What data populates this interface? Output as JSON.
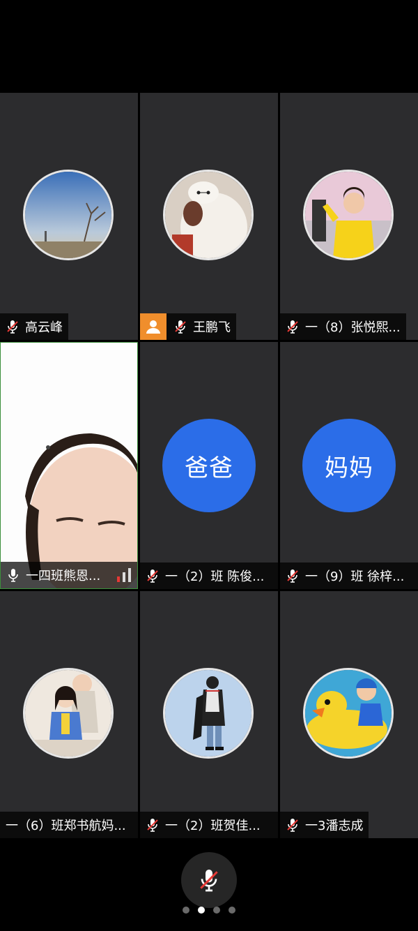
{
  "participants": [
    {
      "name": "高云峰",
      "muted": true,
      "host": false
    },
    {
      "name": "王鹏飞",
      "muted": true,
      "host": true
    },
    {
      "name": "一（8）张悦熙...",
      "muted": true,
      "host": false
    },
    {
      "name": "一四班熊恩...",
      "muted": false,
      "host": false
    },
    {
      "name": "一（2）班 陈俊...",
      "muted": true,
      "host": false,
      "initials": "爸爸"
    },
    {
      "name": "一（9）班  徐梓...",
      "muted": true,
      "host": false,
      "initials": "妈妈"
    },
    {
      "name": "一（6）班郑书航妈...",
      "muted": false,
      "host": false
    },
    {
      "name": "一（2）班贺佳...",
      "muted": true,
      "host": false
    },
    {
      "name": "一3潘志成",
      "muted": true,
      "host": false
    }
  ],
  "pager": {
    "pages": 4,
    "current": 2
  },
  "colors": {
    "tile_bg": "#2c2c2e",
    "avatar_blue": "#2b6de8",
    "host_orange": "#f08e2c",
    "mute_red": "#e53935"
  }
}
